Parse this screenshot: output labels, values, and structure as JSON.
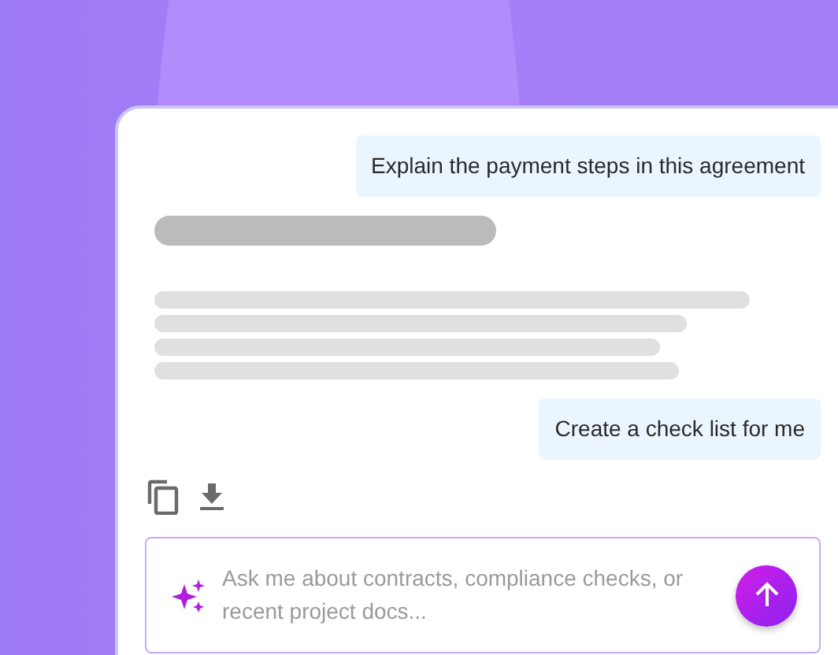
{
  "conversation": [
    {
      "kind": "user",
      "text": "Explain the payment steps in this agreement"
    },
    {
      "kind": "loading"
    },
    {
      "kind": "user",
      "text": "Create a check list for me"
    }
  ],
  "composer": {
    "placeholder": "Ask me about contracts, compliance checks, or recent project docs..."
  }
}
